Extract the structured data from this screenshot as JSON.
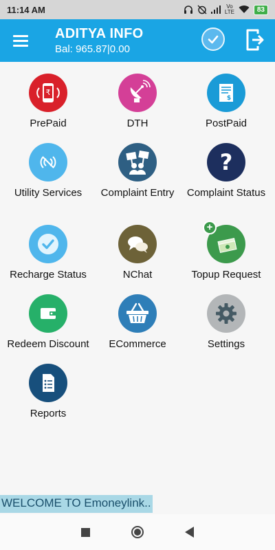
{
  "status": {
    "time": "11:14 AM",
    "battery": "83",
    "network": "Vo LTE"
  },
  "header": {
    "title": "ADITYA INFO",
    "balance": "Bal: 965.87|0.00"
  },
  "grid": [
    {
      "label": "PrePaid",
      "icon": "prepaid-mobile-icon",
      "color": "#d9202a"
    },
    {
      "label": "DTH",
      "icon": "satellite-dish-icon",
      "color": "#d43f97"
    },
    {
      "label": "PostPaid",
      "icon": "bill-document-icon",
      "color": "#1a9bd7"
    },
    {
      "label": "Utility Services",
      "icon": "utility-signal-icon",
      "color": "#4fb6ec"
    },
    {
      "label": "Complaint Entry",
      "icon": "complaint-protest-icon",
      "color": "#2e5f83"
    },
    {
      "label": "Complaint Status",
      "icon": "question-mark-icon",
      "color": "#1d2f5e"
    },
    {
      "label": "Recharge Status",
      "icon": "checkmark-icon",
      "color": "#4fb6ec"
    },
    {
      "label": "NChat",
      "icon": "chat-bubbles-icon",
      "color": "#6d6238"
    },
    {
      "label": "Topup Request",
      "icon": "money-stack-icon",
      "color": "#3c9a4c"
    },
    {
      "label": "Redeem Discount",
      "icon": "wallet-icon",
      "color": "#26b069"
    },
    {
      "label": "ECommerce",
      "icon": "shopping-basket-icon",
      "color": "#2e7eb8"
    },
    {
      "label": "Settings",
      "icon": "gear-icon",
      "color": "#b3b6b8"
    },
    {
      "label": "Reports",
      "icon": "report-document-icon",
      "color": "#174f7c"
    }
  ],
  "footer": {
    "welcome": "WELCOME TO Emoneylink.."
  }
}
